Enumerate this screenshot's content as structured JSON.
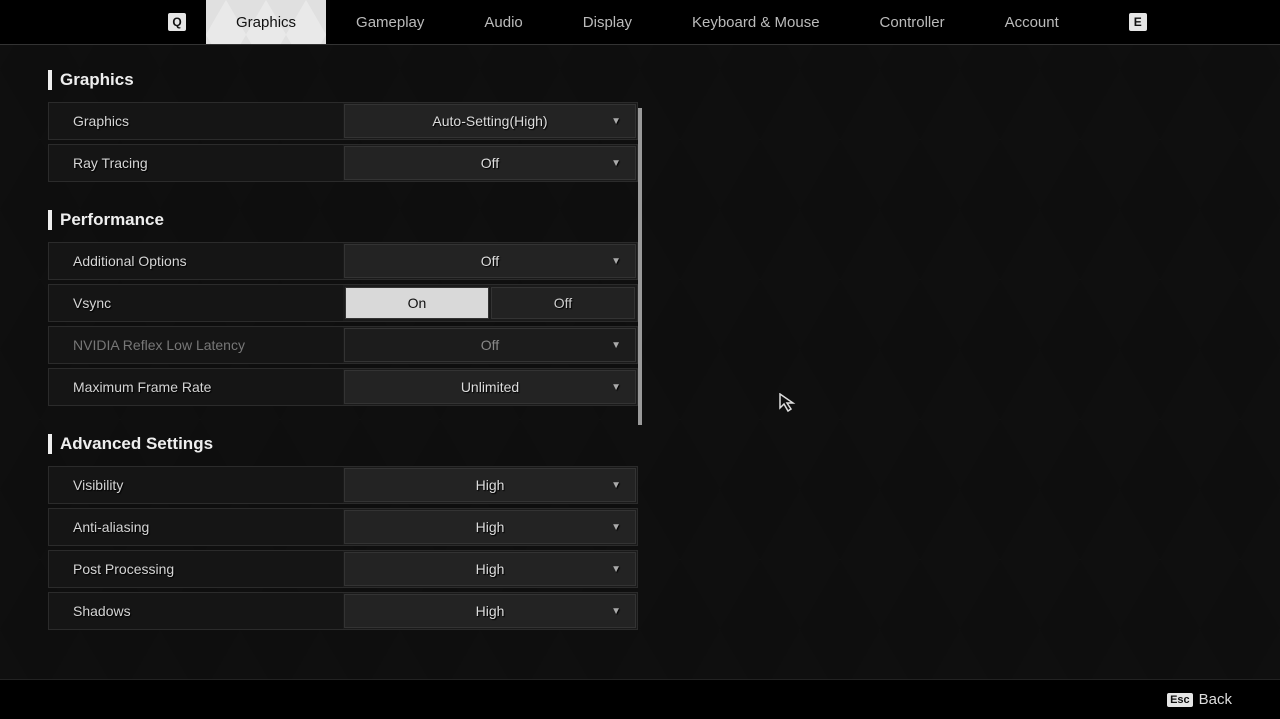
{
  "topbar": {
    "key_left": "Q",
    "key_right": "E",
    "tabs": [
      "Graphics",
      "Gameplay",
      "Audio",
      "Display",
      "Keyboard & Mouse",
      "Controller",
      "Account"
    ],
    "active_index": 0
  },
  "sections": {
    "graphics": {
      "title": "Graphics",
      "rows": {
        "quality": {
          "label": "Graphics",
          "value": "Auto-Setting(High)"
        },
        "raytracing": {
          "label": "Ray Tracing",
          "value": "Off"
        }
      }
    },
    "performance": {
      "title": "Performance",
      "rows": {
        "additional": {
          "label": "Additional Options",
          "value": "Off"
        },
        "vsync": {
          "label": "Vsync",
          "on": "On",
          "off": "Off",
          "selected": "On"
        },
        "reflex": {
          "label": "NVIDIA Reflex Low Latency",
          "value": "Off",
          "disabled": true
        },
        "maxfps": {
          "label": "Maximum Frame Rate",
          "value": "Unlimited"
        }
      }
    },
    "advanced": {
      "title": "Advanced Settings",
      "rows": {
        "visibility": {
          "label": "Visibility",
          "value": "High"
        },
        "aa": {
          "label": "Anti-aliasing",
          "value": "High"
        },
        "postproc": {
          "label": "Post Processing",
          "value": "High"
        },
        "shadows": {
          "label": "Shadows",
          "value": "High"
        }
      }
    }
  },
  "footer": {
    "esc_key": "Esc",
    "back": "Back"
  }
}
